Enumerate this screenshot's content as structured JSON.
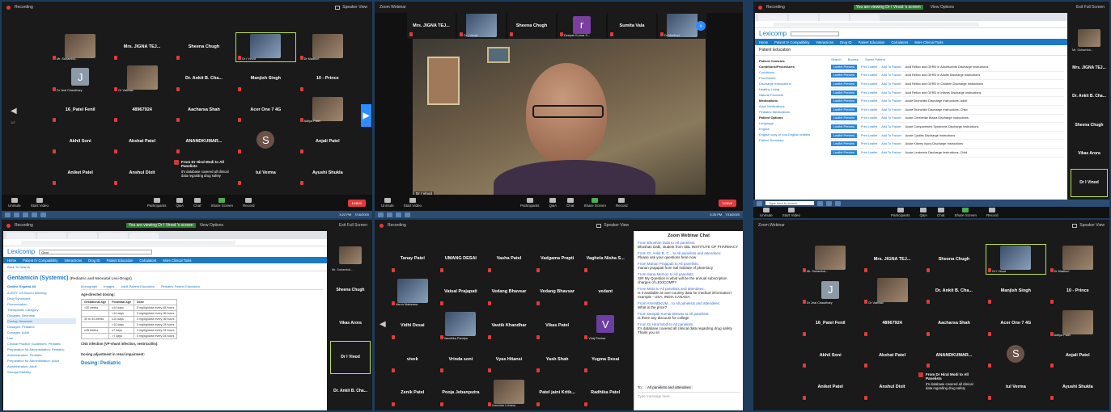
{
  "app": {
    "recording_label": "Recording",
    "speaker_view": "Speaker View",
    "exit_full": "Exit Full Screen",
    "sharing_banner": "You are viewing Dr I Vinod 's screen",
    "view_options": "View Options"
  },
  "toolbar": {
    "unmute": "Unmute",
    "start_video": "Start Video",
    "participants": "Participants",
    "qa": "Q&A",
    "chat": "Chat",
    "share": "Share Screen",
    "record": "Record",
    "end": "Leave"
  },
  "taskbar": {
    "clock_1": "3:22 PM",
    "date_1": "7/16/2020",
    "clock_2": "3:25 PM",
    "date_2": "7/16/2020",
    "search": "Type here to search"
  },
  "panel1": {
    "page_count": "1/2",
    "tiles": [
      {
        "name": "",
        "sub": "Mr. Sohamlok..."
      },
      {
        "name": "Mrs. JIGNA TEJ...",
        "sub": ""
      },
      {
        "name": "Sheena Chugh",
        "sub": ""
      },
      {
        "name": "",
        "sub": "Dr I Vinod"
      },
      {
        "name": "",
        "sub": "Dr Madhuri"
      },
      {
        "name": "J",
        "sub": "Dr Jeal Chaudhary"
      },
      {
        "name": "",
        "sub": "Dr Vaibhav"
      },
      {
        "name": "Dr. Ankit B. Cha...",
        "sub": ""
      },
      {
        "name": "Manjish Singh",
        "sub": ""
      },
      {
        "name": "10 - Prince",
        "sub": ""
      },
      {
        "name": "16_Patel Fenil",
        "sub": ""
      },
      {
        "name": "48967924",
        "sub": ""
      },
      {
        "name": "Aacharsa Shah",
        "sub": ""
      },
      {
        "name": "Acer One 7 4G",
        "sub": ""
      },
      {
        "name": "",
        "sub": "Aditya Patel"
      },
      {
        "name": "Akhil Soni",
        "sub": ""
      },
      {
        "name": "Akshat Patel",
        "sub": ""
      },
      {
        "name": "ANANDKUMAR...",
        "sub": ""
      },
      {
        "name": "S",
        "sub": ""
      },
      {
        "name": "Anjali Patel",
        "sub": ""
      },
      {
        "name": "Aniket Patel",
        "sub": ""
      },
      {
        "name": "Anshul Dixit",
        "sub": ""
      },
      {
        "name": "",
        "sub": ""
      },
      {
        "name": "tul Verma",
        "sub": ""
      },
      {
        "name": "Ayushi Shukla",
        "sub": ""
      }
    ],
    "chat_from": "From Dr Hiral Modi to All Panelists",
    "chat_msg": "it's database covered all clinical data regarding drug safety"
  },
  "panel2": {
    "title": "Zoom Webinar",
    "strip": [
      {
        "name": "Mrs. JIGNA TEJ...",
        "sub": ""
      },
      {
        "name": "",
        "sub": "Dr I Vinod"
      },
      {
        "name": "Sheena Chugh",
        "sub": ""
      },
      {
        "name": "r",
        "sub": "Deepak Kumar S..."
      },
      {
        "name": "Sumita Vala",
        "sub": ""
      },
      {
        "name": "",
        "sub": "Dr Madhuri"
      }
    ],
    "speaker_label": "Dr I Vinod"
  },
  "panel3": {
    "logo": "Lexicomp",
    "nav": [
      "Home",
      "Patient IV Compatibility",
      "Interactions",
      "Drug ID",
      "Patient Education",
      "Calculators",
      "More Clinical Tools"
    ],
    "section_title": "Patient Education",
    "left_nav": [
      "Patient Contents",
      "Conditions/Procedures",
      "Conditions",
      "Procedures",
      "Discharge Instructions",
      "Healthy Living",
      "Natural Products",
      "Medications",
      "Adult Medications",
      "Pediatric Medications",
      "Patient Options",
      "Language",
      "English",
      "English copy of non-English leaflets",
      "Patient Summary"
    ],
    "search_tabs": [
      "Search",
      "Browse",
      "Saved Patient"
    ],
    "rows": [
      "Acid Reflux and GERD in Adolescents Discharge Instructions",
      "Acid Reflux and GERD in Adults Discharge Instructions",
      "Acid Reflux and GERD in Children Discharge Instructions",
      "Acid Reflux and GERD in Infants Discharge Instructions",
      "Acute Bronchitis Discharge Instructions, Adult",
      "Acute Bronchitis Discharge Instructions, Child",
      "Acute Cerebellar Ataxia Discharge Instructions",
      "Acute Compartment Syndrome Discharge Instructions",
      "Acute Cystitis Discharge Instructions",
      "Acute Kidney Injury Discharge Instructions",
      "Acute Leukemia Discharge Instructions, Child"
    ],
    "btn_label": "Leaflet Preview",
    "links": [
      "Print Leaflet",
      "Add To Packet"
    ],
    "side": [
      "Mr. Sohamlok...",
      "Mrs. JIGNA TEJ...",
      "Dr. Ankit B. Cha...",
      "Sheena Chugh",
      "Vikas Arora",
      "Dr I Vinod"
    ]
  },
  "panel4": {
    "logo": "Lexicomp",
    "search_value": "Gent",
    "nav": [
      "Home",
      "Patient IV Compatibility",
      "Interactions",
      "Drug ID",
      "Patient Education",
      "Calculators",
      "More Clinical Tools"
    ],
    "back": "Back To Search",
    "title": "Gentamicin (Systemic)",
    "title_sub": "(Pediatric and Neonatal Lexi-Drugs)",
    "outline_title": "Outline Expand All",
    "outline": [
      "ALERT: US Boxed Warning",
      "Drug Synonyms",
      "Pronunciation",
      "Therapeutic Category",
      "Dosages: Neonatal",
      "Dosing: Neonatal",
      "Dosages: Pediatric",
      "Dosages: Adult",
      "Use",
      "Clinical Practice Guidelines: Pediatric",
      "Preparation for Administration: Pediatric",
      "Administration: Pediatric",
      "Preparation for Administration: Adult",
      "Administration: Adult",
      "Storage/Stability"
    ],
    "tabs": [
      "Monograph",
      "Images",
      "Adult Patient Education",
      "Pediatric Patient Education"
    ],
    "para_heading": "Age-directed dosing:",
    "table_head": [
      "Gestational Age",
      "Postnatal Age",
      "Dose"
    ],
    "table_rows": [
      [
        "<30 weeks",
        "≤14 days",
        "5 mg/kg/dose every 48 hours"
      ],
      [
        "",
        ">14 days",
        "5 mg/kg/dose every 36 hours"
      ],
      [
        "30 to 34 weeks",
        "≤10 days",
        "5 mg/kg/dose every 36 hours"
      ],
      [
        "",
        ">10 days",
        "5 mg/kg/dose every 24 hours"
      ],
      [
        "≥35 weeks",
        "≤7 days",
        "4 mg/kg/dose every 24 hours"
      ],
      [
        "",
        ">7 days",
        "5 mg/kg/dose every 24 hours"
      ]
    ],
    "cns": "CNS infection (VP-shunt infection, ventriculitis):",
    "renal": "Dosing adjustment in renal impairment:",
    "dosing_ped": "Dosing: Pediatric",
    "side": [
      "Mr. Sohamlok...",
      "Sheena Chugh",
      "Vikas Arora",
      "Dr I Vinod",
      "Dr. Ankit B. Cha..."
    ]
  },
  "panel5": {
    "tiles": [
      {
        "name": "Tanay Patel",
        "sub": ""
      },
      {
        "name": "UMANG DESAI",
        "sub": ""
      },
      {
        "name": "Vasha Patel",
        "sub": ""
      },
      {
        "name": "Vadgama Prapti",
        "sub": ""
      },
      {
        "name": "Vaghela Nisha S...",
        "sub": ""
      },
      {
        "name": "",
        "sub": "Varun Makwana"
      },
      {
        "name": "Vatsal Prajapati",
        "sub": ""
      },
      {
        "name": "Vedang Bhavsar",
        "sub": ""
      },
      {
        "name": "Vedang Bhavsar",
        "sub": ""
      },
      {
        "name": "vedant",
        "sub": ""
      },
      {
        "name": "Vidhi Desai",
        "sub": ""
      },
      {
        "name": "",
        "sub": "Vanshika Pandya"
      },
      {
        "name": "Vastik Khandhar",
        "sub": ""
      },
      {
        "name": "Vikas Patel",
        "sub": ""
      },
      {
        "name": "V",
        "sub": "Viraj Parmar"
      },
      {
        "name": "vivek",
        "sub": ""
      },
      {
        "name": "Vrinda soni",
        "sub": ""
      },
      {
        "name": "Vyas Hitansi",
        "sub": ""
      },
      {
        "name": "Yash Shah",
        "sub": ""
      },
      {
        "name": "Yugma Desai",
        "sub": ""
      },
      {
        "name": "Zenik Patel",
        "sub": ""
      },
      {
        "name": "Pooja Jebanputra",
        "sub": ""
      },
      {
        "name": "",
        "sub": "Kanchan Lohana"
      },
      {
        "name": "Patel jaini Kritk...",
        "sub": ""
      },
      {
        "name": "Radhika Patel",
        "sub": ""
      }
    ],
    "chat_title": "Zoom Webinar Chat",
    "chat": [
      {
        "from": "From Bhushan Dabi to All panelists:",
        "msg": "Bhushan Dabi, student from SBL INSTITUTE OF PHARMACY"
      },
      {
        "from": "From Dr. Ankit B. C... to All panelists and attendees:",
        "msg": "Please ask your questions here now"
      },
      {
        "from": "From Manan Prajapati to All panelists:",
        "msg": "manan prajapati from Sal institute of pharmacy"
      },
      {
        "from": "From Sana Memon to All panelists:",
        "msg": "SIR My Question is what will be the annual subscription charges of LEXICOMP?"
      },
      {
        "from": "From Mitra to All panelists and attendees:",
        "msg": "Is it available at over-country data for medical information? example - USA, INDIA CANADA"
      },
      {
        "from": "From ANANDKUM... to All panelists and attendees:",
        "msg": "What is the price?"
      },
      {
        "from": "From Deepak Kumar Biswas to All panelists:",
        "msg": "Is there any discount for college"
      },
      {
        "from": "From Dr Hiral Modi to All panelists:",
        "msg": "It's database covered all clinical data regarding drug safety Thank you sir"
      }
    ],
    "to_label": "To:",
    "to_value": "All panelists and attendees",
    "input_placeholder": "Type message here..."
  }
}
